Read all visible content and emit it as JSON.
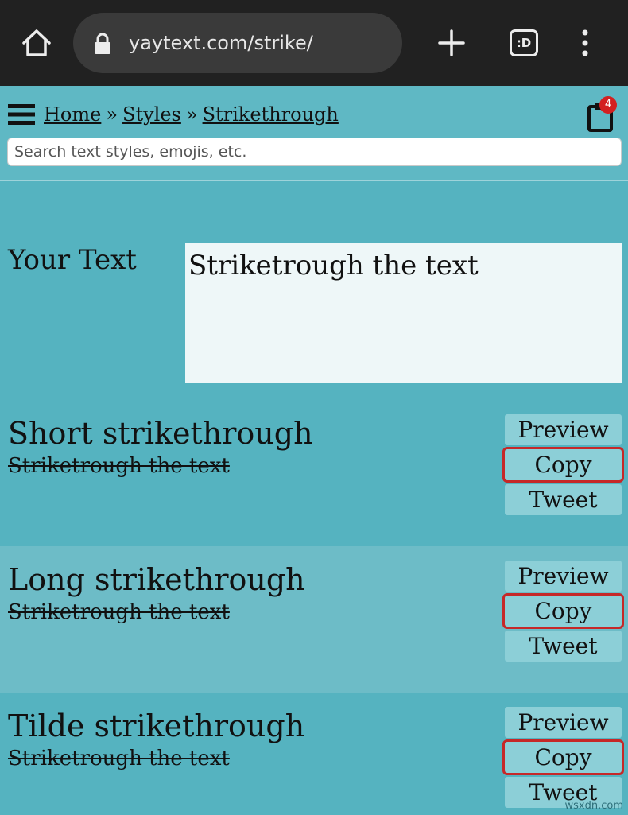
{
  "browser": {
    "url": "yaytext.com/strike/",
    "tab_icon_text": ":D"
  },
  "header": {
    "breadcrumbs": [
      {
        "label": "Home"
      },
      {
        "label": "Styles"
      },
      {
        "label": "Strikethrough"
      }
    ],
    "separator": "»",
    "clipboard_count": "4",
    "search_placeholder": "Search text styles, emojis, etc."
  },
  "input": {
    "label": "Your Text",
    "value": "Striketrough the text"
  },
  "styles": [
    {
      "title": "Short strikethrough",
      "sample": "Striketrough the text",
      "preview_label": "Preview",
      "copy_label": "Copy",
      "tweet_label": "Tweet"
    },
    {
      "title": "Long strikethrough",
      "sample": "Striketrough the text",
      "preview_label": "Preview",
      "copy_label": "Copy",
      "tweet_label": "Tweet"
    },
    {
      "title": "Tilde strikethrough",
      "sample": "Striketrough the text",
      "preview_label": "Preview",
      "copy_label": "Copy",
      "tweet_label": "Tweet"
    }
  ],
  "watermark": "wsxdn.com",
  "colors": {
    "page_bg": "#55b3c0",
    "alt_row_bg": "#6dbcc7",
    "button_bg": "#8ccfd7",
    "highlight_outline": "#c62828",
    "badge": "#d32121"
  }
}
